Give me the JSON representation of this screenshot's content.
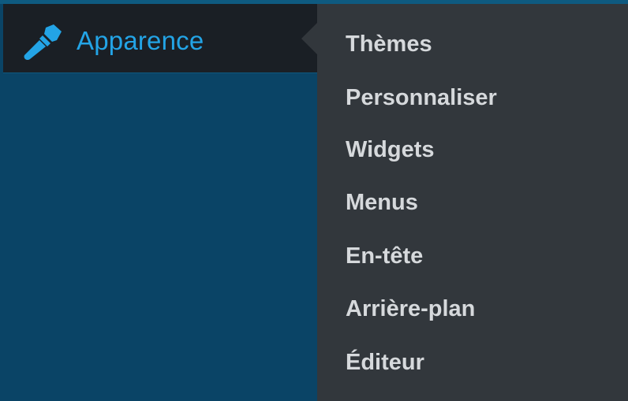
{
  "sidebar": {
    "active_item": {
      "icon": "paintbrush-icon",
      "label": "Apparence"
    }
  },
  "submenu": {
    "items": [
      {
        "label": "Thèmes"
      },
      {
        "label": "Personnaliser"
      },
      {
        "label": "Widgets"
      },
      {
        "label": "Menus"
      },
      {
        "label": "En-tête"
      },
      {
        "label": "Arrière-plan"
      },
      {
        "label": "Éditeur"
      }
    ]
  },
  "colors": {
    "sidebar_background": "#0a4466",
    "active_item_background": "#1a1f25",
    "active_item_text": "#23a4e6",
    "submenu_background": "#32373c",
    "submenu_text": "#d6d9dc"
  }
}
